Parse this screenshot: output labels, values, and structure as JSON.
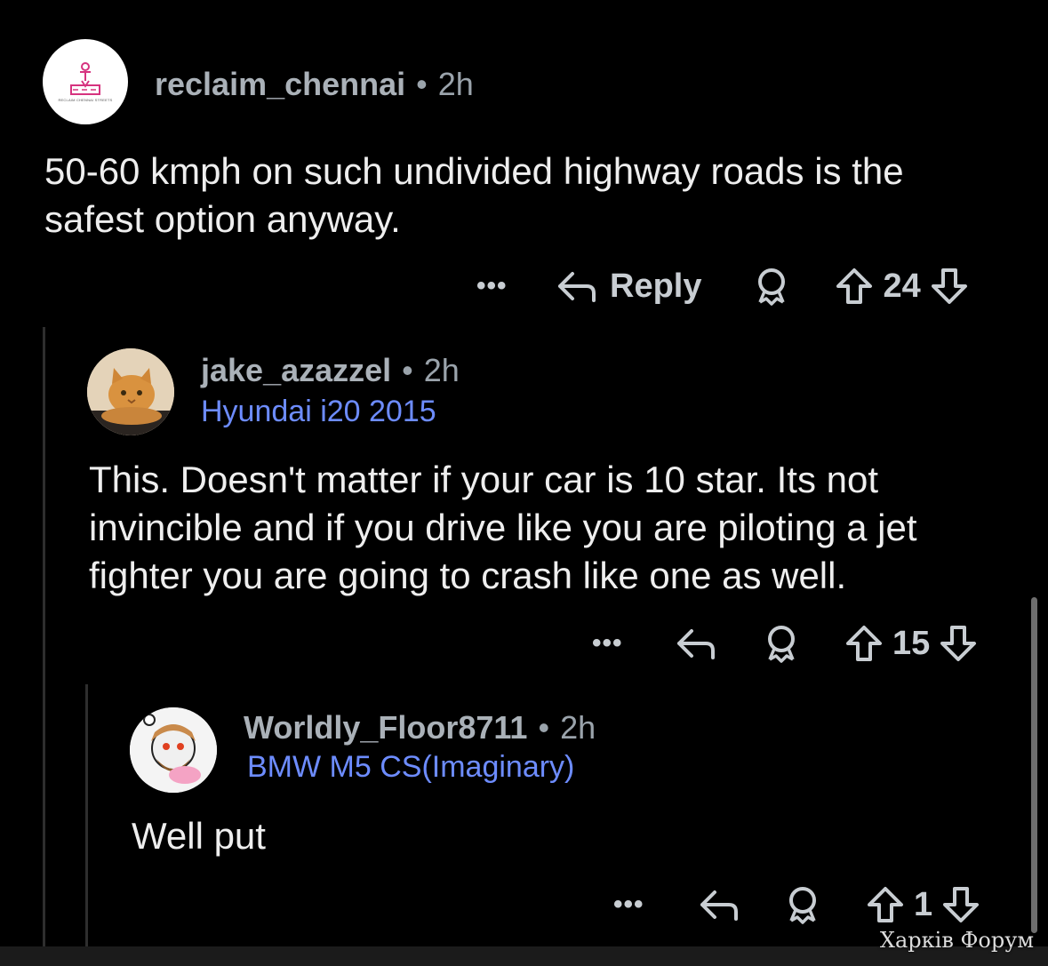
{
  "comments": [
    {
      "username": "reclaim_chennai",
      "age": "2h",
      "flair": "",
      "body": "50-60 kmph on such undivided highway roads is the safest option anyway.",
      "more_label": "•••",
      "reply_label": "Reply",
      "score": "24",
      "avatar_caption": "RECLAIM CHENNAI STREETS"
    },
    {
      "username": "jake_azazzel",
      "age": "2h",
      "flair": "Hyundai i20 2015",
      "body": "This. Doesn't matter if your car is 10 star. Its not invincible and if you drive like you are piloting a jet fighter you are going to crash like one as well.",
      "more_label": "•••",
      "score": "15"
    },
    {
      "username": "Worldly_Floor8711",
      "age": "2h",
      "flair": "BMW M5 CS(Imaginary)",
      "body": "Well put",
      "more_label": "•••",
      "score": "1"
    }
  ],
  "separator": "•",
  "watermark": "Харків Форум",
  "colors": {
    "background": "#000000",
    "username": "#aab1b8",
    "flair": "#6d8cff",
    "body_text": "#eeeeee",
    "icons": "#b8bec4"
  },
  "icons": [
    "reply-arrow-icon",
    "award-icon",
    "upvote-icon",
    "downvote-icon",
    "more-icon"
  ]
}
